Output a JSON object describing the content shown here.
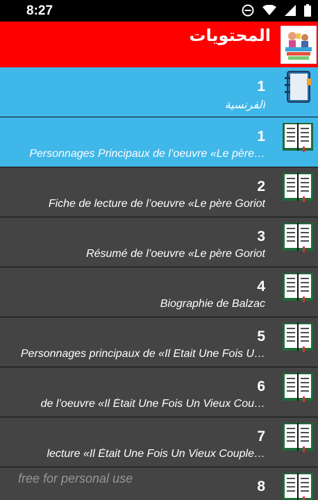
{
  "status": {
    "time": "8:27"
  },
  "header": {
    "title": "المحتويات",
    "logo_icon": "books-logo-icon"
  },
  "colors": {
    "header_red": "#ff0000",
    "active_blue": "#40b7e9",
    "row_dark": "#444444"
  },
  "rows": [
    {
      "num": "1",
      "subtitle": "الفرنسية",
      "icon": "notebook-icon",
      "style": "active"
    },
    {
      "num": "1",
      "subtitle": "Personnages Principaux de l’oeuvre «Le père…",
      "icon": "open-book-icon",
      "style": "active"
    },
    {
      "num": "2",
      "subtitle": "Fiche de lecture de l’oeuvre «Le père Goriot",
      "icon": "open-book-icon",
      "style": "dark"
    },
    {
      "num": "3",
      "subtitle": "Résumé de l’oeuvre «Le père Goriot",
      "icon": "open-book-icon",
      "style": "dark"
    },
    {
      "num": "4",
      "subtitle": "Biographie de Balzac",
      "icon": "open-book-icon",
      "style": "dark"
    },
    {
      "num": "5",
      "subtitle": "Personnages principaux de «Il Etait Une Fois U…",
      "icon": "open-book-icon",
      "style": "dark"
    },
    {
      "num": "6",
      "subtitle": "de l’oeuvre «Il Était Une Fois Un Vieux Cou…",
      "icon": "open-book-icon",
      "style": "dark"
    },
    {
      "num": "7",
      "subtitle": "lecture «Il Était Une Fois Un Vieux Couple…",
      "icon": "open-book-icon",
      "style": "dark"
    },
    {
      "num": "8",
      "subtitle": "",
      "icon": "open-book-icon",
      "style": "dark"
    }
  ],
  "watermark": "free for personal use"
}
